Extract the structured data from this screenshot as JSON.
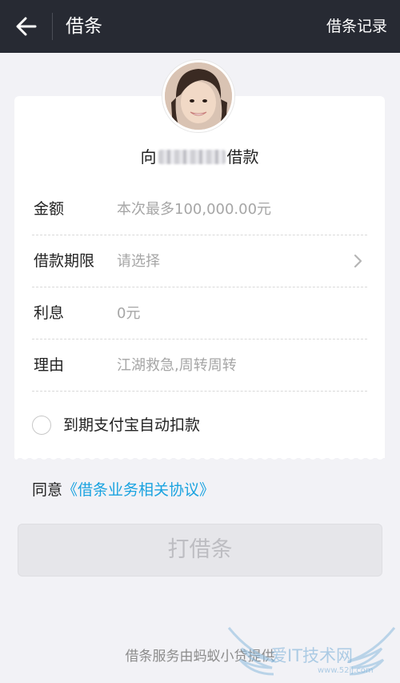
{
  "header": {
    "title": "借条",
    "right_action": "借条记录",
    "back_icon": "arrow-left-icon"
  },
  "card": {
    "borrow_prefix": "向",
    "borrow_suffix": "借款",
    "fields": [
      {
        "label": "金额",
        "placeholder": "本次最多100,000.00元"
      },
      {
        "label": "借款期限",
        "placeholder": "请选择"
      },
      {
        "label": "利息",
        "value": "0元"
      },
      {
        "label": "理由",
        "placeholder": "江湖救急,周转周转"
      }
    ],
    "auto_debit_label": "到期支付宝自动扣款"
  },
  "agreement": {
    "prefix": "同意",
    "link": "《借条业务相关协议》"
  },
  "submit_label": "打借条",
  "footer_text": "借条服务由蚂蚁小贷提供",
  "watermark": {
    "text": "爱IT技术网",
    "url": "www.52ij.com"
  },
  "colors": {
    "header_bg": "#272a33",
    "page_bg": "#f2f2f6",
    "link": "#1aa3e0",
    "placeholder": "#a6a6a6",
    "button_disabled_bg": "#e6e6ea"
  }
}
